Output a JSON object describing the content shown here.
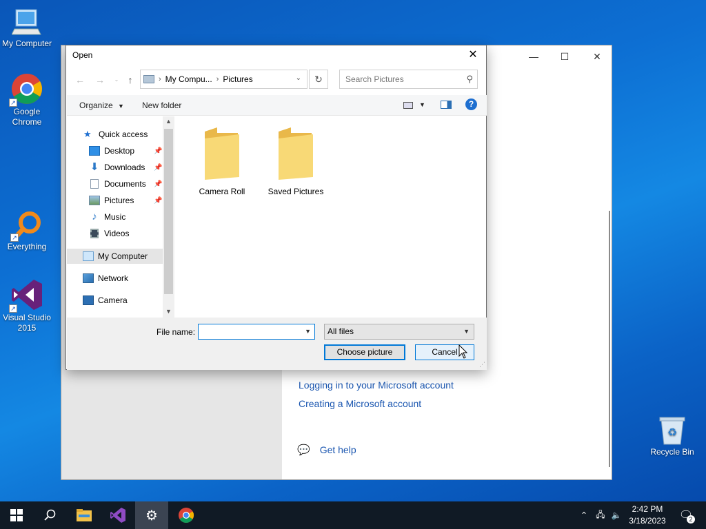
{
  "desktop": {
    "icons": [
      {
        "label": "My Computer"
      },
      {
        "label": "Google Chrome"
      },
      {
        "label": "Everything"
      },
      {
        "label": "Visual Studio 2015"
      },
      {
        "label": "Recycle Bin"
      }
    ]
  },
  "background_window": {
    "links": [
      "Logging in to your Microsoft account",
      "Creating a Microsoft account"
    ],
    "help_label": "Get help"
  },
  "dialog": {
    "title": "Open",
    "breadcrumb": [
      "My Compu...",
      "Pictures"
    ],
    "search_placeholder": "Search Pictures",
    "toolbar": {
      "organize": "Organize",
      "new_folder": "New folder"
    },
    "nav_items": [
      {
        "label": "Quick access",
        "icon": "star-icon"
      },
      {
        "label": "Desktop",
        "icon": "desktop-folder-icon",
        "pinned": true
      },
      {
        "label": "Downloads",
        "icon": "download-arrow-icon",
        "pinned": true
      },
      {
        "label": "Documents",
        "icon": "document-icon",
        "pinned": true
      },
      {
        "label": "Pictures",
        "icon": "pictures-icon",
        "pinned": true
      },
      {
        "label": "Music",
        "icon": "music-note-icon"
      },
      {
        "label": "Videos",
        "icon": "film-icon"
      },
      {
        "label": "My Computer",
        "icon": "computer-icon",
        "selected": true
      },
      {
        "label": "Network",
        "icon": "network-icon"
      },
      {
        "label": "Camera",
        "icon": "camera-icon"
      }
    ],
    "folders": [
      "Camera Roll",
      "Saved Pictures"
    ],
    "file_name_label": "File name:",
    "file_name_value": "",
    "file_type": "All files",
    "choose_button": "Choose picture",
    "cancel_button": "Cancel"
  },
  "taskbar": {
    "time": "2:42 PM",
    "date": "3/18/2023",
    "notification_count": "2"
  },
  "colors": {
    "accent": "#0078d7",
    "link": "#1a56b0",
    "taskbar": "#101a25",
    "folder": "#f3d36b"
  }
}
